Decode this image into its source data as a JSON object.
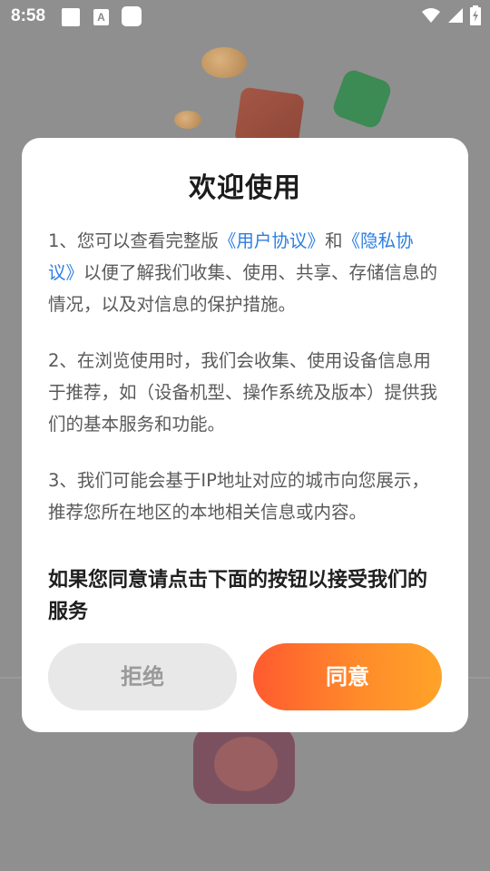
{
  "status_bar": {
    "time": "8:58",
    "notification_a": "A"
  },
  "dialog": {
    "title": "欢迎使用",
    "para1": {
      "prefix": "1、您可以查看完整版",
      "link_user_agreement": "《用户协议》",
      "middle": "和",
      "link_privacy": "《隐私协议》",
      "suffix": "以便了解我们收集、使用、共享、存储信息的情况，以及对信息的保护措施。"
    },
    "para2": "2、在浏览使用时，我们会收集、使用设备信息用于推荐，如（设备机型、操作系统及版本）提供我们的基本服务和功能。",
    "para3": "3、我们可能会基于IP地址对应的城市向您展示，推荐您所在地区的本地相关信息或内容。",
    "consent_text": "如果您同意请点击下面的按钮以接受我们的服务",
    "reject_label": "拒绝",
    "agree_label": "同意"
  },
  "colors": {
    "link": "#2d7ee0",
    "agree_gradient_start": "#ff5a2f",
    "agree_gradient_end": "#ffa329",
    "reject_bg": "#e8e8e8"
  }
}
